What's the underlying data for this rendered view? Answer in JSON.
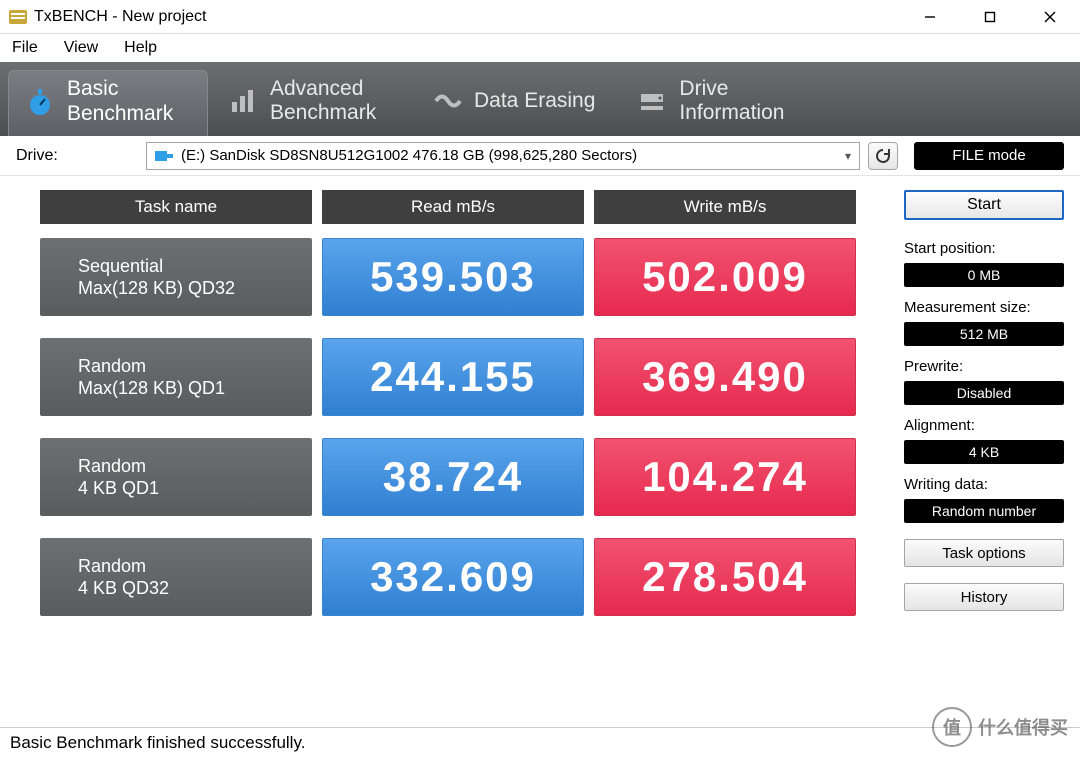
{
  "window": {
    "title": "TxBENCH - New project"
  },
  "menu": {
    "file": "File",
    "view": "View",
    "help": "Help"
  },
  "tabs": {
    "basic": {
      "line1": "Basic",
      "line2": "Benchmark"
    },
    "advanced": {
      "line1": "Advanced",
      "line2": "Benchmark"
    },
    "erase": {
      "line1": "Data Erasing",
      "line2": ""
    },
    "drive": {
      "line1": "Drive",
      "line2": "Information"
    }
  },
  "drive_row": {
    "label": "Drive:",
    "selected": "(E:) SanDisk SD8SN8U512G1002  476.18 GB (998,625,280 Sectors)",
    "filemode": "FILE mode"
  },
  "headers": {
    "task": "Task name",
    "read": "Read mB/s",
    "write": "Write mB/s"
  },
  "rows": [
    {
      "name_l1": "Sequential",
      "name_l2": "Max(128 KB) QD32",
      "read": "539.503",
      "write": "502.009"
    },
    {
      "name_l1": "Random",
      "name_l2": "Max(128 KB) QD1",
      "read": "244.155",
      "write": "369.490"
    },
    {
      "name_l1": "Random",
      "name_l2": "4 KB QD1",
      "read": "38.724",
      "write": "104.274"
    },
    {
      "name_l1": "Random",
      "name_l2": "4 KB QD32",
      "read": "332.609",
      "write": "278.504"
    }
  ],
  "side": {
    "start": "Start",
    "start_position_label": "Start position:",
    "start_position_value": "0 MB",
    "meas_size_label": "Measurement size:",
    "meas_size_value": "512 MB",
    "prewrite_label": "Prewrite:",
    "prewrite_value": "Disabled",
    "alignment_label": "Alignment:",
    "alignment_value": "4 KB",
    "writing_label": "Writing data:",
    "writing_value": "Random number",
    "task_options": "Task options",
    "history": "History"
  },
  "status": "Basic Benchmark finished successfully.",
  "watermark": {
    "badge": "值",
    "text": "什么值得买"
  },
  "chart_data": {
    "type": "table",
    "title": "TxBENCH Basic Benchmark — Read/Write mB/s",
    "columns": [
      "Task",
      "Read mB/s",
      "Write mB/s"
    ],
    "rows": [
      [
        "Sequential Max(128 KB) QD32",
        539.503,
        502.009
      ],
      [
        "Random Max(128 KB) QD1",
        244.155,
        369.49
      ],
      [
        "Random 4 KB QD1",
        38.724,
        104.274
      ],
      [
        "Random 4 KB QD32",
        332.609,
        278.504
      ]
    ]
  }
}
